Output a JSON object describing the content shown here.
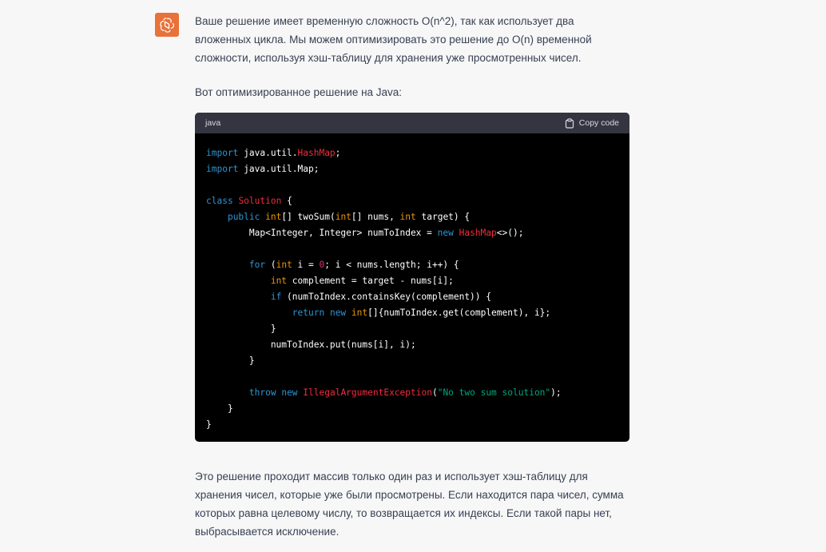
{
  "assistant": {
    "avatar_icon": "openai-logo-icon",
    "avatar_color": "#e8723a",
    "intro_text": "Ваше решение имеет временную сложность O(n^2), так как использует два вложенных цикла. Мы можем оптимизировать это решение до O(n) временной сложности, используя хэш-таблицу для хранения уже просмотренных чисел.",
    "lead_in": "Вот оптимизированное решение на Java:",
    "code_block": {
      "language": "java",
      "copy_label": "Copy code",
      "copy_icon": "clipboard-icon",
      "lines": [
        "import java.util.HashMap;",
        "import java.util.Map;",
        "",
        "class Solution {",
        "    public int[] twoSum(int[] nums, int target) {",
        "        Map<Integer, Integer> numToIndex = new HashMap<>();",
        "",
        "        for (int i = 0; i < nums.length; i++) {",
        "            int complement = target - nums[i];",
        "            if (numToIndex.containsKey(complement)) {",
        "                return new int[]{numToIndex.get(complement), i};",
        "            }",
        "            numToIndex.put(nums[i], i);",
        "        }",
        "",
        "        throw new IllegalArgumentException(\"No two sum solution\");",
        "    }",
        "}"
      ]
    },
    "outro_text": "Это решение проходит массив только один раз и использует хэш-таблицу для хранения чисел, которые уже были просмотрены. Если находится пара чисел, сумма которых равна целевому числу, то возвращается их индексы. Если такой пары нет, выбрасывается исключение."
  },
  "colors": {
    "page_bg": "#f7f7f8",
    "code_bg": "#000000",
    "code_header_bg": "#343541",
    "keyword": "#2e95d3",
    "type": "#e9950c",
    "class_name": "#f22c3d",
    "number": "#df3079",
    "string": "#00a67d"
  }
}
